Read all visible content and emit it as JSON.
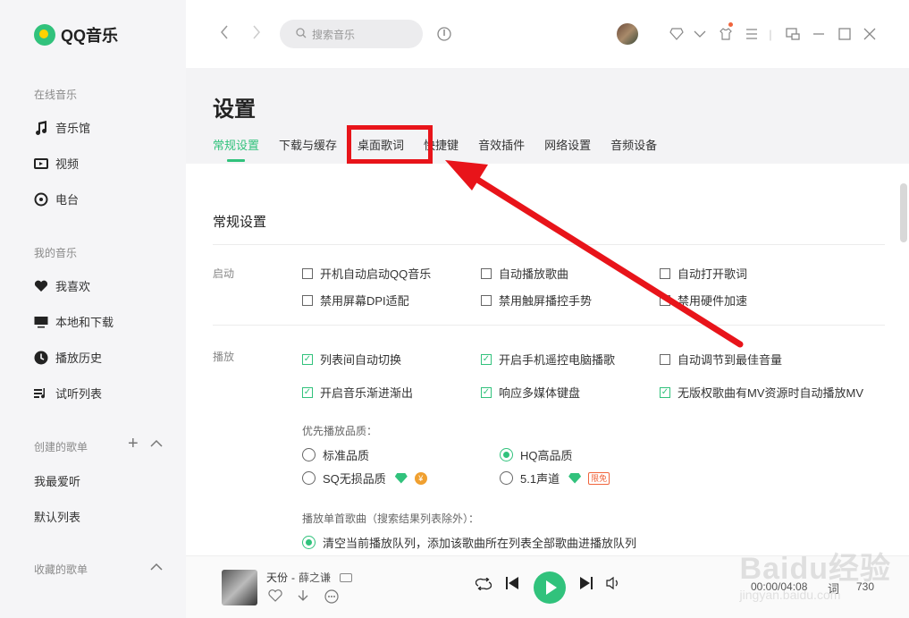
{
  "app": {
    "name": "QQ音乐"
  },
  "sidebar": {
    "online_section": "在线音乐",
    "online_items": [
      {
        "label": "音乐馆",
        "icon": "music-note-icon"
      },
      {
        "label": "视频",
        "icon": "video-icon"
      },
      {
        "label": "电台",
        "icon": "radio-icon"
      }
    ],
    "my_section": "我的音乐",
    "my_items": [
      {
        "label": "我喜欢",
        "icon": "heart-icon"
      },
      {
        "label": "本地和下载",
        "icon": "monitor-icon"
      },
      {
        "label": "播放历史",
        "icon": "clock-icon"
      },
      {
        "label": "试听列表",
        "icon": "playlist-icon"
      }
    ],
    "created_section": "创建的歌单",
    "created_playlists": [
      "我最爱听",
      "默认列表"
    ],
    "collected_section": "收藏的歌单"
  },
  "topbar": {
    "search_placeholder": "搜索音乐"
  },
  "settings": {
    "title": "设置",
    "tabs": [
      "常规设置",
      "下载与缓存",
      "桌面歌词",
      "快捷键",
      "音效插件",
      "网络设置",
      "音频设备"
    ],
    "active_tab": "常规设置",
    "section_title": "常规设置",
    "startup": {
      "label": "启动",
      "options": [
        {
          "label": "开机自动启动QQ音乐",
          "checked": false
        },
        {
          "label": "自动播放歌曲",
          "checked": false
        },
        {
          "label": "自动打开歌词",
          "checked": false
        },
        {
          "label": "禁用屏幕DPI适配",
          "checked": false
        },
        {
          "label": "禁用触屏播控手势",
          "checked": false
        },
        {
          "label": "禁用硬件加速",
          "checked": false
        }
      ]
    },
    "playback": {
      "label": "播放",
      "options": [
        {
          "label": "列表间自动切换",
          "checked": true
        },
        {
          "label": "开启手机遥控电脑播歌",
          "checked": true
        },
        {
          "label": "自动调节到最佳音量",
          "checked": false
        },
        {
          "label": "开启音乐渐进渐出",
          "checked": true
        },
        {
          "label": "响应多媒体键盘",
          "checked": true
        },
        {
          "label": "无版权歌曲有MV资源时自动播放MV",
          "checked": true
        }
      ],
      "quality_label": "优先播放品质：",
      "quality_options": [
        {
          "label": "标准品质",
          "selected": false
        },
        {
          "label": "HQ高品质",
          "selected": true
        },
        {
          "label": "SQ无损品质",
          "selected": false
        },
        {
          "label": "5.1声道",
          "selected": false
        }
      ],
      "limited_badge": "限免",
      "single_song_label": "播放单首歌曲（搜索结果列表除外）：",
      "single_song_option": "清空当前播放队列，添加该歌曲所在列表全部歌曲进播放队列"
    }
  },
  "player": {
    "song_title": "天份",
    "separator": "-",
    "artist": "薛之谦",
    "time": "00:00/04:08",
    "lyric_label": "词",
    "queue_count": "730"
  },
  "watermark": {
    "main": "Baidu经验",
    "sub": "jingyan.baidu.com"
  },
  "colors": {
    "accent": "#31c27c",
    "annotation": "#e8141a"
  }
}
